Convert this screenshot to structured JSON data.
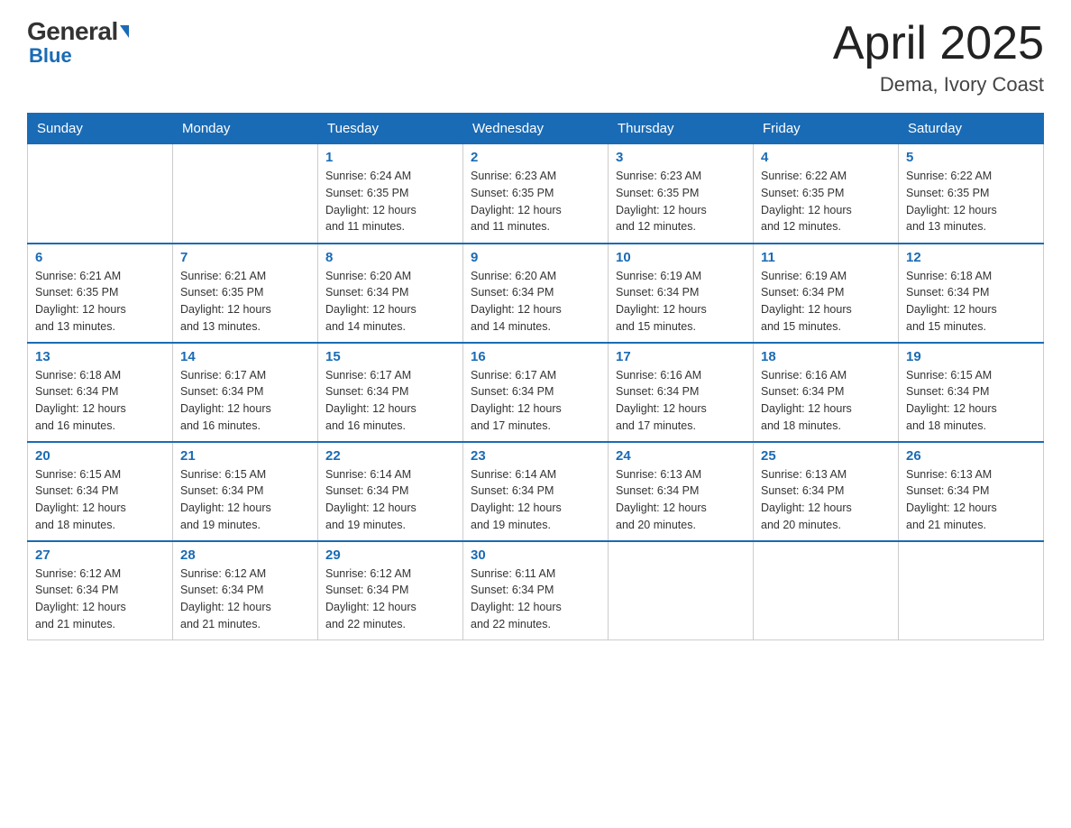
{
  "logo": {
    "general": "General",
    "blue": "Blue"
  },
  "title": "April 2025",
  "subtitle": "Dema, Ivory Coast",
  "days_of_week": [
    "Sunday",
    "Monday",
    "Tuesday",
    "Wednesday",
    "Thursday",
    "Friday",
    "Saturday"
  ],
  "weeks": [
    [
      {
        "day": "",
        "info": ""
      },
      {
        "day": "",
        "info": ""
      },
      {
        "day": "1",
        "info": "Sunrise: 6:24 AM\nSunset: 6:35 PM\nDaylight: 12 hours\nand 11 minutes."
      },
      {
        "day": "2",
        "info": "Sunrise: 6:23 AM\nSunset: 6:35 PM\nDaylight: 12 hours\nand 11 minutes."
      },
      {
        "day": "3",
        "info": "Sunrise: 6:23 AM\nSunset: 6:35 PM\nDaylight: 12 hours\nand 12 minutes."
      },
      {
        "day": "4",
        "info": "Sunrise: 6:22 AM\nSunset: 6:35 PM\nDaylight: 12 hours\nand 12 minutes."
      },
      {
        "day": "5",
        "info": "Sunrise: 6:22 AM\nSunset: 6:35 PM\nDaylight: 12 hours\nand 13 minutes."
      }
    ],
    [
      {
        "day": "6",
        "info": "Sunrise: 6:21 AM\nSunset: 6:35 PM\nDaylight: 12 hours\nand 13 minutes."
      },
      {
        "day": "7",
        "info": "Sunrise: 6:21 AM\nSunset: 6:35 PM\nDaylight: 12 hours\nand 13 minutes."
      },
      {
        "day": "8",
        "info": "Sunrise: 6:20 AM\nSunset: 6:34 PM\nDaylight: 12 hours\nand 14 minutes."
      },
      {
        "day": "9",
        "info": "Sunrise: 6:20 AM\nSunset: 6:34 PM\nDaylight: 12 hours\nand 14 minutes."
      },
      {
        "day": "10",
        "info": "Sunrise: 6:19 AM\nSunset: 6:34 PM\nDaylight: 12 hours\nand 15 minutes."
      },
      {
        "day": "11",
        "info": "Sunrise: 6:19 AM\nSunset: 6:34 PM\nDaylight: 12 hours\nand 15 minutes."
      },
      {
        "day": "12",
        "info": "Sunrise: 6:18 AM\nSunset: 6:34 PM\nDaylight: 12 hours\nand 15 minutes."
      }
    ],
    [
      {
        "day": "13",
        "info": "Sunrise: 6:18 AM\nSunset: 6:34 PM\nDaylight: 12 hours\nand 16 minutes."
      },
      {
        "day": "14",
        "info": "Sunrise: 6:17 AM\nSunset: 6:34 PM\nDaylight: 12 hours\nand 16 minutes."
      },
      {
        "day": "15",
        "info": "Sunrise: 6:17 AM\nSunset: 6:34 PM\nDaylight: 12 hours\nand 16 minutes."
      },
      {
        "day": "16",
        "info": "Sunrise: 6:17 AM\nSunset: 6:34 PM\nDaylight: 12 hours\nand 17 minutes."
      },
      {
        "day": "17",
        "info": "Sunrise: 6:16 AM\nSunset: 6:34 PM\nDaylight: 12 hours\nand 17 minutes."
      },
      {
        "day": "18",
        "info": "Sunrise: 6:16 AM\nSunset: 6:34 PM\nDaylight: 12 hours\nand 18 minutes."
      },
      {
        "day": "19",
        "info": "Sunrise: 6:15 AM\nSunset: 6:34 PM\nDaylight: 12 hours\nand 18 minutes."
      }
    ],
    [
      {
        "day": "20",
        "info": "Sunrise: 6:15 AM\nSunset: 6:34 PM\nDaylight: 12 hours\nand 18 minutes."
      },
      {
        "day": "21",
        "info": "Sunrise: 6:15 AM\nSunset: 6:34 PM\nDaylight: 12 hours\nand 19 minutes."
      },
      {
        "day": "22",
        "info": "Sunrise: 6:14 AM\nSunset: 6:34 PM\nDaylight: 12 hours\nand 19 minutes."
      },
      {
        "day": "23",
        "info": "Sunrise: 6:14 AM\nSunset: 6:34 PM\nDaylight: 12 hours\nand 19 minutes."
      },
      {
        "day": "24",
        "info": "Sunrise: 6:13 AM\nSunset: 6:34 PM\nDaylight: 12 hours\nand 20 minutes."
      },
      {
        "day": "25",
        "info": "Sunrise: 6:13 AM\nSunset: 6:34 PM\nDaylight: 12 hours\nand 20 minutes."
      },
      {
        "day": "26",
        "info": "Sunrise: 6:13 AM\nSunset: 6:34 PM\nDaylight: 12 hours\nand 21 minutes."
      }
    ],
    [
      {
        "day": "27",
        "info": "Sunrise: 6:12 AM\nSunset: 6:34 PM\nDaylight: 12 hours\nand 21 minutes."
      },
      {
        "day": "28",
        "info": "Sunrise: 6:12 AM\nSunset: 6:34 PM\nDaylight: 12 hours\nand 21 minutes."
      },
      {
        "day": "29",
        "info": "Sunrise: 6:12 AM\nSunset: 6:34 PM\nDaylight: 12 hours\nand 22 minutes."
      },
      {
        "day": "30",
        "info": "Sunrise: 6:11 AM\nSunset: 6:34 PM\nDaylight: 12 hours\nand 22 minutes."
      },
      {
        "day": "",
        "info": ""
      },
      {
        "day": "",
        "info": ""
      },
      {
        "day": "",
        "info": ""
      }
    ]
  ]
}
